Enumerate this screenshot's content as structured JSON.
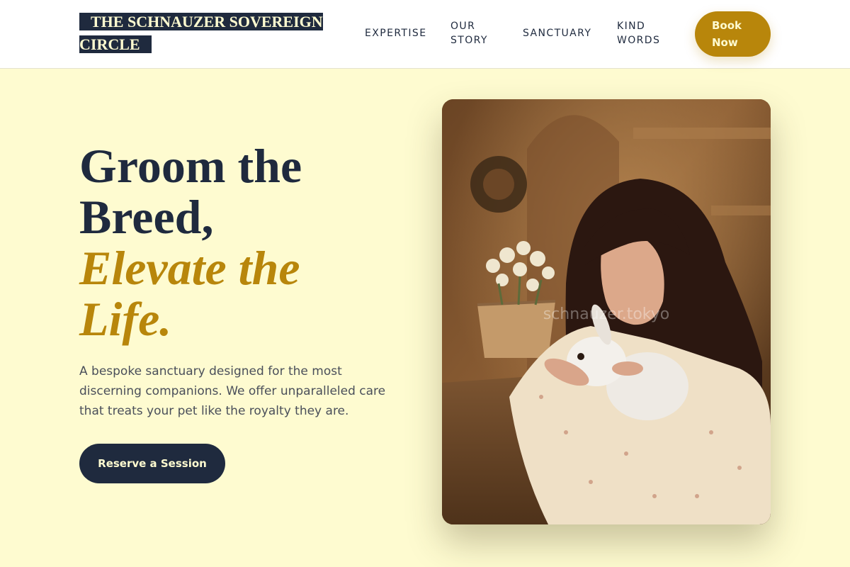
{
  "header": {
    "logo_line1": "THE SCHNAUZER SOVEREIGN",
    "logo_line2": "CIRCLE",
    "nav": {
      "expertise": "EXPERTISE",
      "story": "OUR STORY",
      "sanctuary": "SANCTUARY",
      "words": "KIND WORDS"
    },
    "book_label": "Book Now"
  },
  "hero": {
    "title_line1": "Groom the",
    "title_line2": "Breed,",
    "title_accent_line1": "Elevate the",
    "title_accent_line2": "Life.",
    "description": "A bespoke sanctuary designed for the most discerning companions. We offer unparalleled care that treats your pet like the royalty they are.",
    "cta_label": "Reserve a Session"
  },
  "photo": {
    "watermark": "schnauzer.tokyo"
  },
  "colors": {
    "navy": "#1f2a3e",
    "gold": "#b8860b",
    "cream": "#fefbd0"
  }
}
